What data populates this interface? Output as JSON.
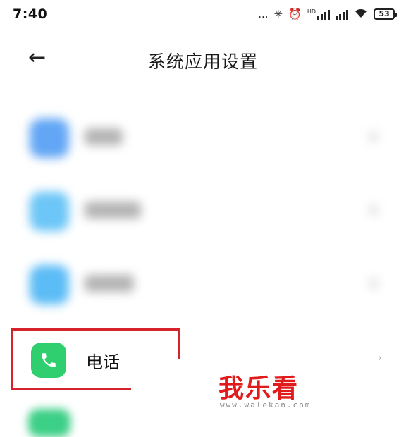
{
  "status": {
    "time": "7:40",
    "dots": "...",
    "bluetooth": "✳",
    "alarm": "⏰",
    "hd": "HD",
    "battery": "53"
  },
  "header": {
    "back_icon": "←",
    "title": "系统应用设置"
  },
  "list": {
    "blurred_rows": [
      {
        "icon": "blue-app-icon",
        "color": "#62a6f5"
      },
      {
        "icon": "light-blue-app-icon",
        "color": "#6cc6f7"
      },
      {
        "icon": "sky-blue-app-icon",
        "color": "#5cbcf6"
      }
    ],
    "phone": {
      "label": "电话",
      "icon": "phone-icon",
      "icon_color": "#2fce6f",
      "chevron": "‹"
    }
  },
  "watermark": {
    "title": "我乐看",
    "url": "www.walekan.com"
  },
  "highlight_color": "#d6222a"
}
